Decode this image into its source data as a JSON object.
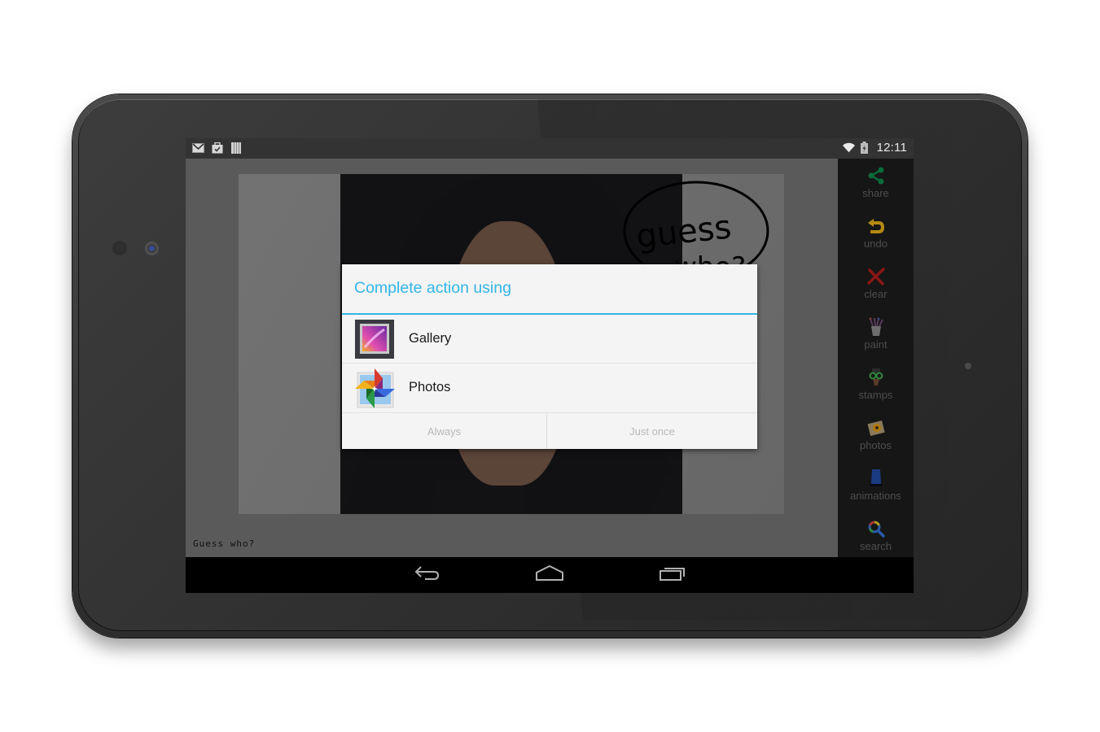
{
  "status_bar": {
    "left_icons": [
      "gmail-icon",
      "clipboard-check-icon",
      "barcode-icon"
    ],
    "right_icons": [
      "wifi-icon",
      "battery-charging-icon"
    ],
    "time": "12:11"
  },
  "canvas": {
    "bubble_text": "guess who?",
    "caption": "Guess who?"
  },
  "toolbar": {
    "items": [
      {
        "label": "share",
        "icon": "share-icon",
        "color": "#0b6b3a"
      },
      {
        "label": "undo",
        "icon": "undo-icon",
        "color": "#b58a12"
      },
      {
        "label": "clear",
        "icon": "clear-x-icon",
        "color": "#8a1616"
      },
      {
        "label": "paint",
        "icon": "paint-brushes-icon",
        "color": "#6e6e6e"
      },
      {
        "label": "stamps",
        "icon": "stamps-icon",
        "color": "#2e8a3a"
      },
      {
        "label": "photos",
        "icon": "photos-icon",
        "color": "#b07a10"
      },
      {
        "label": "animations",
        "icon": "animations-icon",
        "color": "#1b3b80"
      },
      {
        "label": "search",
        "icon": "search-icon",
        "color": "#2a5aa8"
      }
    ]
  },
  "dialog": {
    "title": "Complete action using",
    "accent": "#33b5e5",
    "apps": [
      {
        "name": "Gallery",
        "icon": "gallery-app-icon"
      },
      {
        "name": "Photos",
        "icon": "photos-app-icon"
      }
    ],
    "buttons": {
      "always": "Always",
      "just_once": "Just once"
    }
  },
  "nav_bar": {
    "buttons": [
      "back-icon",
      "home-icon",
      "recents-icon"
    ]
  }
}
